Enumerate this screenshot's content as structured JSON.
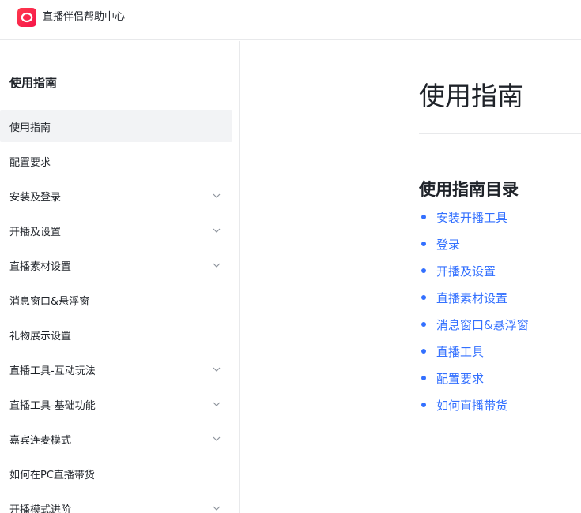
{
  "header": {
    "brand_name": "直播伴侣帮助中心",
    "logo_icon": "live-logo-icon",
    "brand_color": "#fe2c55"
  },
  "sidebar": {
    "title": "使用指南",
    "items": [
      {
        "label": "使用指南",
        "active": true,
        "expandable": false
      },
      {
        "label": "配置要求",
        "active": false,
        "expandable": false
      },
      {
        "label": "安装及登录",
        "active": false,
        "expandable": true
      },
      {
        "label": "开播及设置",
        "active": false,
        "expandable": true
      },
      {
        "label": "直播素材设置",
        "active": false,
        "expandable": true
      },
      {
        "label": "消息窗口&悬浮窗",
        "active": false,
        "expandable": false
      },
      {
        "label": "礼物展示设置",
        "active": false,
        "expandable": false
      },
      {
        "label": "直播工具-互动玩法",
        "active": false,
        "expandable": true
      },
      {
        "label": "直播工具-基础功能",
        "active": false,
        "expandable": true
      },
      {
        "label": "嘉宾连麦模式",
        "active": false,
        "expandable": true
      },
      {
        "label": "如何在PC直播带货",
        "active": false,
        "expandable": false
      },
      {
        "label": "开播模式进阶",
        "active": false,
        "expandable": true
      }
    ]
  },
  "main": {
    "title": "使用指南",
    "toc_title": "使用指南目录",
    "toc": [
      "安装开播工具",
      "登录",
      "开播及设置",
      "直播素材设置",
      "消息窗口&悬浮窗",
      "直播工具",
      "配置要求",
      "如何直播带货"
    ],
    "link_color": "#3370ff"
  }
}
